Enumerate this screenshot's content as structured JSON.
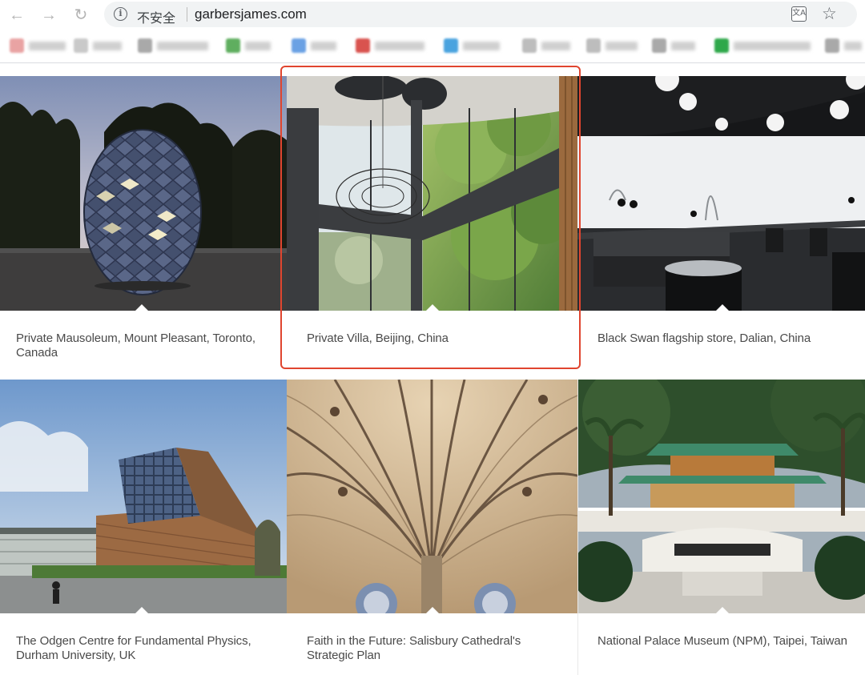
{
  "browser": {
    "back_icon": "arrow-left-icon",
    "forward_icon": "arrow-right-icon",
    "reload_icon": "reload-icon",
    "security_label": "不安全",
    "url": "garbersjames.com",
    "translate_icon": "translate-icon",
    "bookmark_icon": "star-icon"
  },
  "bookmarks_bar": {
    "note": "",
    "items": [
      {
        "icon_color": "#e9a3a3"
      },
      {
        "icon_color": "#b9b9b9"
      },
      {
        "icon_color": "#9a9a9a"
      },
      {
        "icon_color": "#5fae5f"
      },
      {
        "icon_color": "#6aa1e4"
      },
      {
        "icon_color": "#d9534f"
      },
      {
        "icon_color": "#4aa3df"
      },
      {
        "icon_color": "#b5b5b5"
      },
      {
        "icon_color": "#b5b5b5"
      },
      {
        "icon_color": "#9a9a9a"
      },
      {
        "icon_color": "#2ea84a"
      },
      {
        "icon_color": "#9a9a9a"
      }
    ]
  },
  "gallery": {
    "projects": [
      {
        "caption": "Private Mausoleum, Mount Pleasant, Toronto, Canada",
        "image": "egg-shaped lattice mausoleum at dusk"
      },
      {
        "caption": "Private Villa, Beijing, China",
        "image": "curved glass villa interior with trees",
        "highlighted": true
      },
      {
        "caption": "Black Swan flagship store, Dalian, China",
        "image": "dark store interior with display cases"
      },
      {
        "caption": "The Odgen Centre for Fundamental Physics, Durham University, UK",
        "image": "angular glass and timber building"
      },
      {
        "caption": "Faith in the Future: Salisbury Cathedral's Strategic Plan",
        "image": "gothic fan vaulted ceiling"
      },
      {
        "caption": "National Palace Museum (NPM), Taipei, Taiwan",
        "image": "palace museum with green roof and palms"
      }
    ]
  },
  "colors": {
    "highlight_border": "#e0452f",
    "caption_text": "#4a4a4a"
  }
}
